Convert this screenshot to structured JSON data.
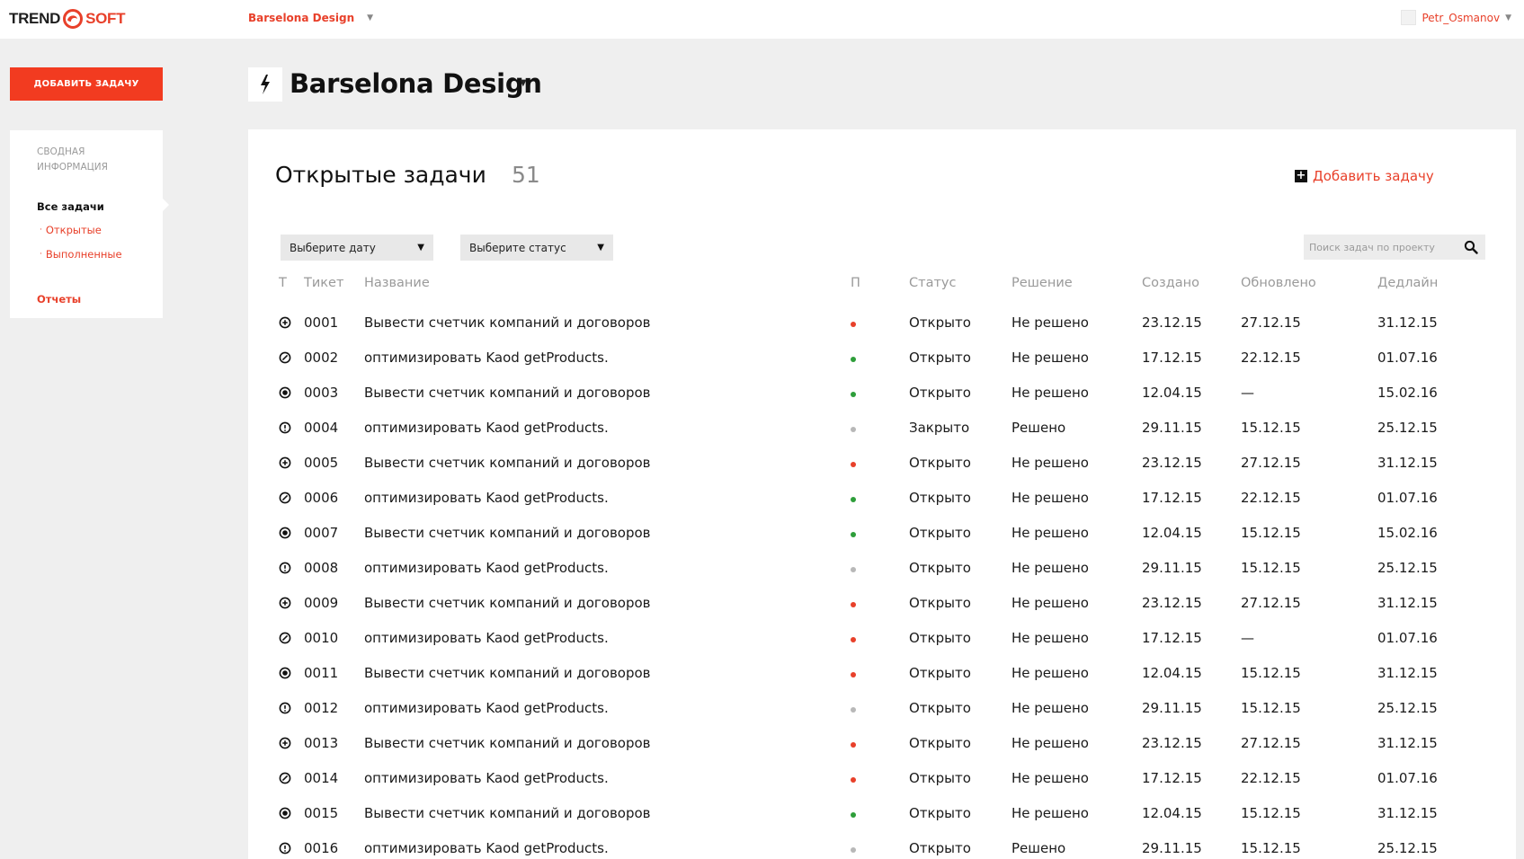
{
  "header": {
    "logo_left": "TREND",
    "logo_right": "SOFT",
    "project_switch": "Barselona Design",
    "user_name": "Petr_Osmanov"
  },
  "sidebar": {
    "add_task_button": "ДОБАВИТЬ ЗАДАЧУ",
    "summary": "СВОДНАЯ ИНФОРМАЦИЯ",
    "all_tasks": "Все задачи",
    "open": "Открытые",
    "done": "Выполненные",
    "reports": "Отчеты"
  },
  "project": {
    "title": "Barselona Design"
  },
  "panel": {
    "title": "Открытые задачи",
    "count": "51",
    "add_link": "Добавить задачу",
    "date_filter": "Выберите дату",
    "status_filter": "Выберите статус",
    "search_placeholder": "Поиск задач по проекту"
  },
  "table": {
    "columns": {
      "type": "Т",
      "ticket": "Тикет",
      "name": "Название",
      "priority": "П",
      "status": "Статус",
      "resolution": "Решение",
      "created": "Создано",
      "updated": "Обновлено",
      "deadline": "Дедлайн"
    },
    "rows": [
      {
        "type": "plus",
        "ticket": "0001",
        "name": "Вывести счетчик компаний и договоров",
        "priority": "red",
        "status": "Открыто",
        "resolution": "Не решено",
        "created": "23.12.15",
        "updated": "27.12.15",
        "deadline": "31.12.15"
      },
      {
        "type": "slash",
        "ticket": "0002",
        "name": "оптимизировать Kaod getProducts.",
        "priority": "green",
        "status": "Открыто",
        "resolution": "Не решено",
        "created": "17.12.15",
        "updated": "22.12.15",
        "deadline": "01.07.16"
      },
      {
        "type": "dot",
        "ticket": "0003",
        "name": "Вывести счетчик компаний и договоров",
        "priority": "green",
        "status": "Открыто",
        "resolution": "Не решено",
        "created": "12.04.15",
        "updated": "—",
        "deadline": "15.02.16"
      },
      {
        "type": "bang",
        "ticket": "0004",
        "name": "оптимизировать Kaod getProducts.",
        "priority": "gray",
        "status": "Закрыто",
        "resolution": "Решено",
        "created": "29.11.15",
        "updated": "15.12.15",
        "deadline": "25.12.15"
      },
      {
        "type": "plus",
        "ticket": "0005",
        "name": "Вывести счетчик компаний и договоров",
        "priority": "red",
        "status": "Открыто",
        "resolution": "Не решено",
        "created": "23.12.15",
        "updated": "27.12.15",
        "deadline": "31.12.15"
      },
      {
        "type": "slash",
        "ticket": "0006",
        "name": "оптимизировать Kaod getProducts.",
        "priority": "green",
        "status": "Открыто",
        "resolution": "Не решено",
        "created": "17.12.15",
        "updated": "22.12.15",
        "deadline": "01.07.16"
      },
      {
        "type": "dot",
        "ticket": "0007",
        "name": "Вывести счетчик компаний и договоров",
        "priority": "green",
        "status": "Открыто",
        "resolution": "Не решено",
        "created": "12.04.15",
        "updated": "15.12.15",
        "deadline": "15.02.16"
      },
      {
        "type": "bang",
        "ticket": "0008",
        "name": "оптимизировать Kaod getProducts.",
        "priority": "gray",
        "status": "Открыто",
        "resolution": "Не решено",
        "created": "29.11.15",
        "updated": "15.12.15",
        "deadline": "25.12.15"
      },
      {
        "type": "plus",
        "ticket": "0009",
        "name": "Вывести счетчик компаний и договоров",
        "priority": "red",
        "status": "Открыто",
        "resolution": "Не решено",
        "created": "23.12.15",
        "updated": "27.12.15",
        "deadline": "31.12.15"
      },
      {
        "type": "slash",
        "ticket": "0010",
        "name": "оптимизировать Kaod getProducts.",
        "priority": "red",
        "status": "Открыто",
        "resolution": "Не решено",
        "created": "17.12.15",
        "updated": "—",
        "deadline": "01.07.16"
      },
      {
        "type": "dot",
        "ticket": "0011",
        "name": "Вывести счетчик компаний и договоров",
        "priority": "red",
        "status": "Открыто",
        "resolution": "Не решено",
        "created": "12.04.15",
        "updated": "15.12.15",
        "deadline": "31.12.15"
      },
      {
        "type": "bang",
        "ticket": "0012",
        "name": "оптимизировать Kaod getProducts.",
        "priority": "gray",
        "status": "Открыто",
        "resolution": "Не решено",
        "created": "29.11.15",
        "updated": "15.12.15",
        "deadline": "25.12.15"
      },
      {
        "type": "plus",
        "ticket": "0013",
        "name": "Вывести счетчик компаний и договоров",
        "priority": "red",
        "status": "Открыто",
        "resolution": "Не решено",
        "created": "23.12.15",
        "updated": "27.12.15",
        "deadline": "31.12.15"
      },
      {
        "type": "slash",
        "ticket": "0014",
        "name": "оптимизировать Kaod getProducts.",
        "priority": "red",
        "status": "Открыто",
        "resolution": "Не решено",
        "created": "17.12.15",
        "updated": "22.12.15",
        "deadline": "01.07.16"
      },
      {
        "type": "dot",
        "ticket": "0015",
        "name": "Вывести счетчик компаний и договоров",
        "priority": "green",
        "status": "Открыто",
        "resolution": "Не решено",
        "created": "12.04.15",
        "updated": "15.12.15",
        "deadline": "31.12.15"
      },
      {
        "type": "bang",
        "ticket": "0016",
        "name": "оптимизировать Kaod getProducts.",
        "priority": "gray",
        "status": "Открыто",
        "resolution": "Решено",
        "created": "29.11.15",
        "updated": "15.12.15",
        "deadline": "25.12.15"
      }
    ]
  },
  "colors": {
    "accent": "#e8402a",
    "priority_red": "#e8402a",
    "priority_green": "#2e9e3a",
    "priority_gray": "#b8b8b8"
  }
}
